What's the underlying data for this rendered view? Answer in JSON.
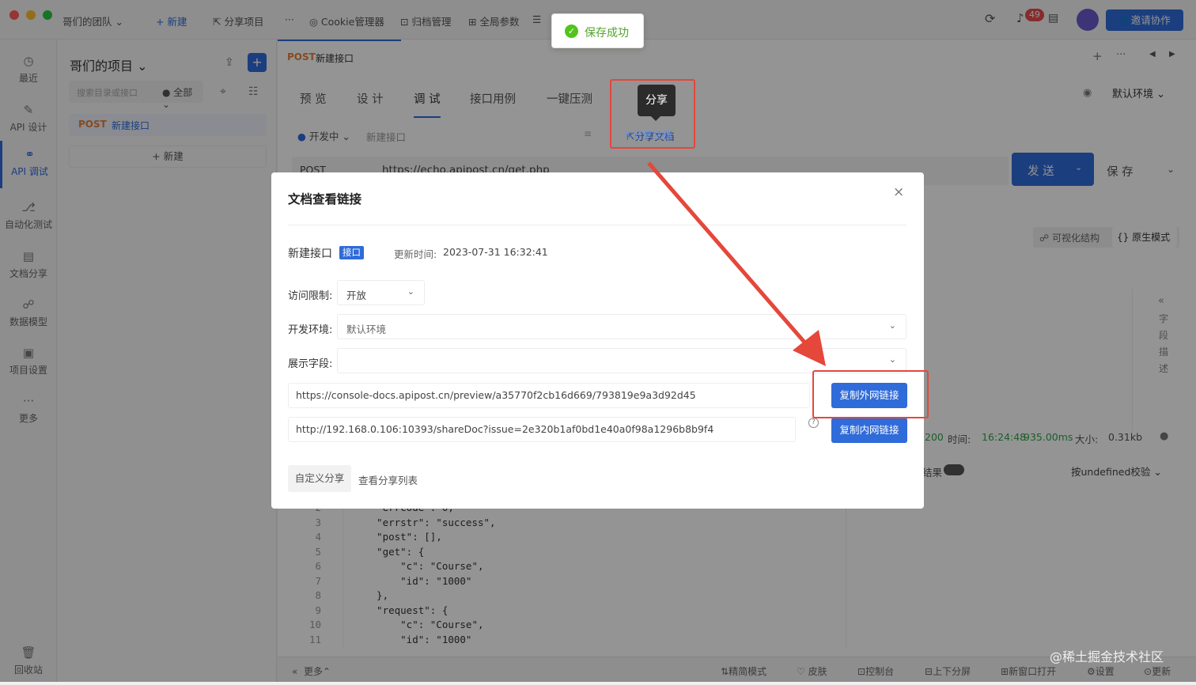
{
  "titlebar": {
    "team": "哥们的团队",
    "new": "新建",
    "share_project": "分享项目",
    "more": "···",
    "cookie": "Cookie管理器",
    "archive": "归档管理",
    "global_params": "全局参数",
    "notifications": "49",
    "invite": "邀请协作"
  },
  "toast": {
    "text": "保存成功"
  },
  "rail": {
    "items": [
      {
        "label": "最近",
        "icon": "clock-icon"
      },
      {
        "label": "API 设计",
        "icon": "edit-icon"
      },
      {
        "label": "API 调试",
        "icon": "link-icon"
      },
      {
        "label": "自动化测试",
        "icon": "flow-icon"
      },
      {
        "label": "文档分享",
        "icon": "doc-icon"
      },
      {
        "label": "数据模型",
        "icon": "model-icon"
      },
      {
        "label": "项目设置",
        "icon": "folder-gear-icon"
      },
      {
        "label": "更多",
        "icon": "more-icon"
      }
    ],
    "trash": "回收站"
  },
  "tree": {
    "project": "哥们的项目",
    "search_placeholder": "搜索目录或接口",
    "filter": "全部",
    "item_method": "POST",
    "item_name": "新建接口",
    "new_label": "+ 新建"
  },
  "main": {
    "tab_method": "POST",
    "tab_name": "新建接口",
    "tabs": [
      "预 览",
      "设 计",
      "调 试",
      "接口用例",
      "一键压测"
    ],
    "env": "默认环境",
    "status": "开发中",
    "api_name": "新建接口",
    "share_doc": "分享文档",
    "share_tooltip": "分享",
    "method": "POST",
    "url": "https://echo.apipost.cn/get.php",
    "send": "发 送",
    "save": "保 存",
    "visual": "可视化结构",
    "raw": "原生模式",
    "side_title": "字段描述",
    "resp_status": "200",
    "resp_time_label": "时间:",
    "resp_time": "16:24:48",
    "resp_ms": "935.00ms",
    "resp_size_label": "大小:",
    "resp_size": "0.31kb",
    "result_label": "结果",
    "verify": "按undefined校验",
    "code": [
      {
        "n": "2",
        "t": "  \"errcode\": 0,"
      },
      {
        "n": "3",
        "t": "  \"errstr\": \"success\","
      },
      {
        "n": "4",
        "t": "  \"post\": [],"
      },
      {
        "n": "5",
        "t": "  \"get\": {"
      },
      {
        "n": "6",
        "t": "      \"c\": \"Course\","
      },
      {
        "n": "7",
        "t": "      \"id\": \"1000\""
      },
      {
        "n": "8",
        "t": "  },"
      },
      {
        "n": "9",
        "t": "  \"request\": {"
      },
      {
        "n": "10",
        "t": "      \"c\": \"Course\","
      },
      {
        "n": "11",
        "t": "      \"id\": \"1000\""
      }
    ]
  },
  "bottombar": {
    "more": "更多",
    "simple": "精简模式",
    "skin": "皮肤",
    "console": "控制台",
    "split": "上下分屏",
    "new_window": "新窗口打开",
    "settings": "设置",
    "update": "更新",
    "watermark": "@稀土掘金技术社区"
  },
  "modal": {
    "title": "文档查看链接",
    "api_name": "新建接口",
    "badge": "接口",
    "updated_label": "更新时间:",
    "updated": "2023-07-31 16:32:41",
    "access_label": "访问限制:",
    "access_value": "开放",
    "env_label": "开发环境:",
    "env_value": "默认环境",
    "fields_label": "展示字段:",
    "fields_value": "",
    "external_url": "https://console-docs.apipost.cn/preview/a35770f2cb16d669/793819e9a3d92d45",
    "copy_external": "复制外网链接",
    "internal_url": "http://192.168.0.106:10393/shareDoc?issue=2e320b1af0bd1e40a0f98a1296b8b9f4",
    "copy_internal": "复制内网链接",
    "custom_share": "自定义分享",
    "share_list": "查看分享列表"
  },
  "colors": {
    "accent": "#2f6bd9",
    "highlight": "#e5473b",
    "success": "#52c41a"
  }
}
